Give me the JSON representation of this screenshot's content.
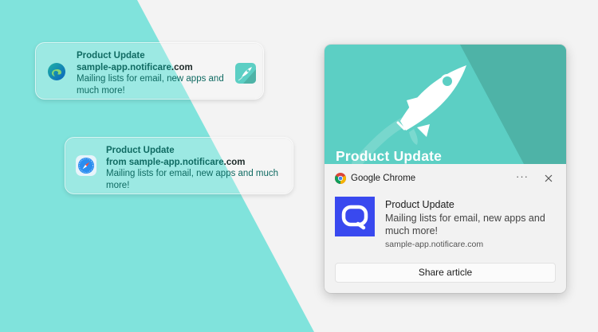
{
  "colors": {
    "teal": "#80e3dc",
    "page_background": "#f3f3f3",
    "hero_teal": "#5ccfc4",
    "hero_dark_teal": "#4eb3a7",
    "logo_blue": "#3949ef"
  },
  "mac_notification_edge": {
    "title": "Product Update",
    "subtitle": "sample-app.notificare",
    "subtitle_suffix": ".com",
    "body": "Mailing lists for email, new apps and much more!",
    "app_icon": "edge-icon",
    "thumbnail_icon": "rocket-icon"
  },
  "mac_notification_safari": {
    "title": "Product Update",
    "subtitle_prefix": "from ",
    "subtitle": "sample-app.notificare",
    "subtitle_suffix": ".com",
    "body": "Mailing lists for email, new apps and much more!",
    "app_icon": "safari-icon"
  },
  "windows_toast": {
    "hero_title": "Product Update",
    "app_name": "Google Chrome",
    "more_label": "···",
    "title": "Product Update",
    "body": "Mailing lists for email, new apps and much more!",
    "attribution": "sample-app.notificare.com",
    "action_label": "Share article",
    "app_icon": "chrome-icon",
    "logo_icon": "notificare-logo-icon"
  }
}
